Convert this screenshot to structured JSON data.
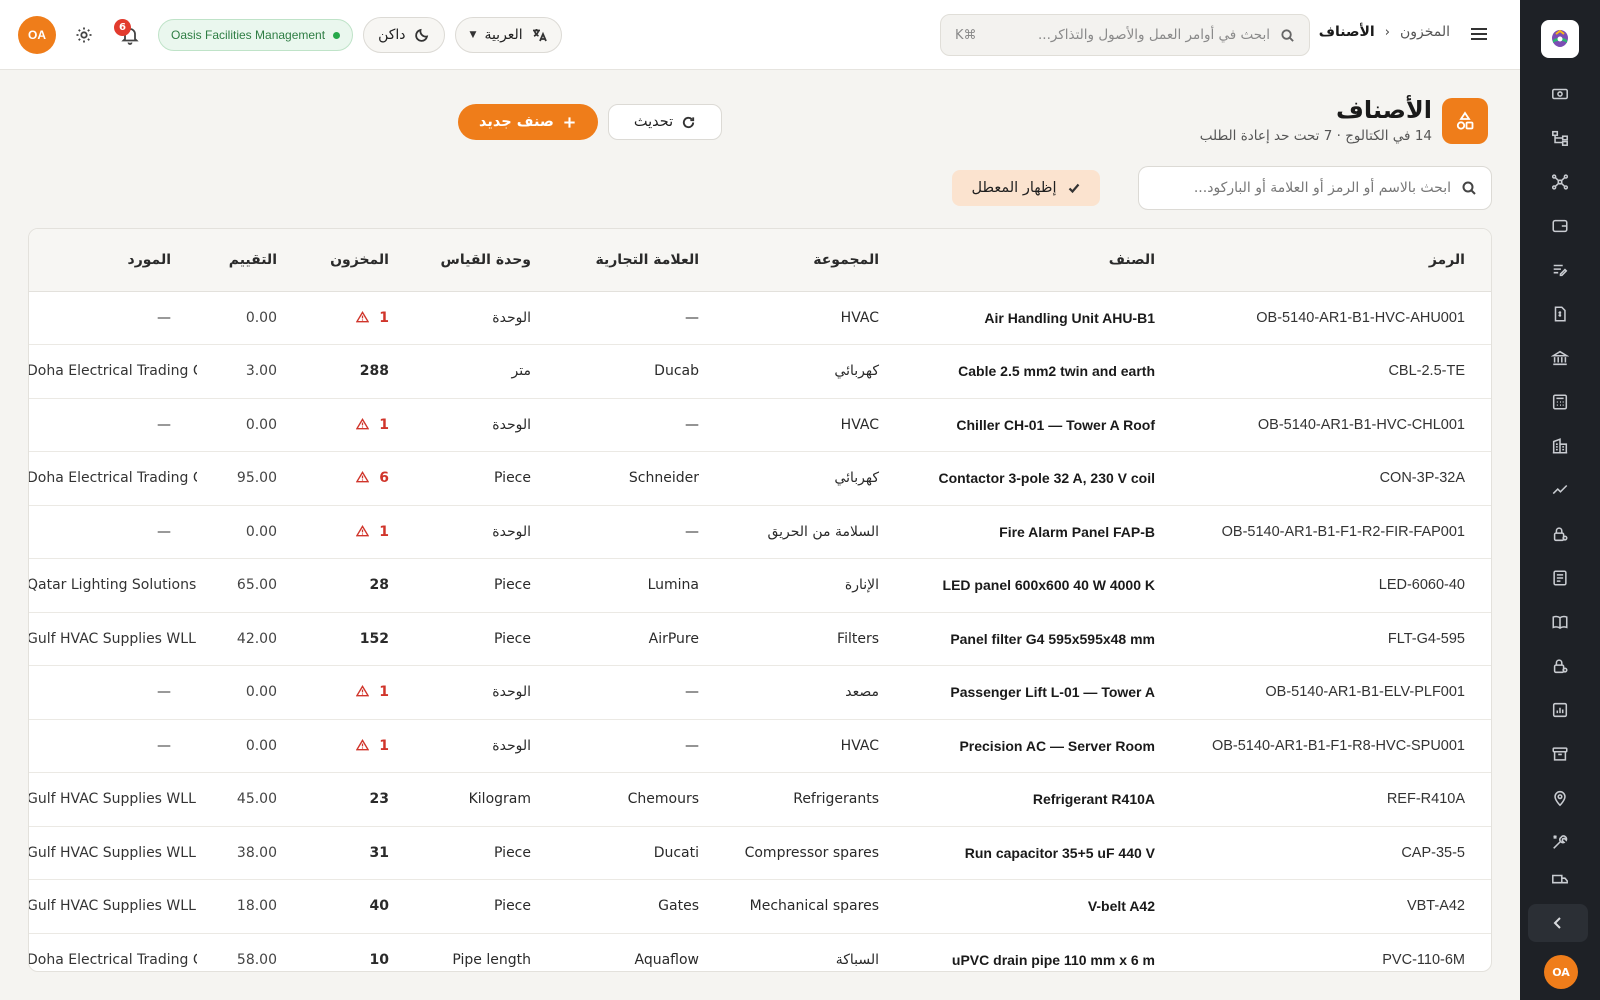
{
  "app": {
    "org_name": "Oasis Facilities Management",
    "user_initials": "OA",
    "notifications_count": "6",
    "language_label": "العربية",
    "theme_label": "داكن",
    "accent_color": "#ef7d1a"
  },
  "topbar": {
    "breadcrumb_parent": "المخزون",
    "breadcrumb_current": "الأصناف",
    "search_placeholder": "ابحث في أوامر العمل والأصول والتذاكر...",
    "search_shortcut": "⌘K"
  },
  "page": {
    "title": "الأصناف",
    "subtitle": "14 في الكتالوج · 7 تحت حد إعادة الطلب",
    "new_button": "صنف جديد",
    "refresh_button": "تحديث",
    "filter_placeholder": "ابحث بالاسم أو الرمز أو العلامة أو الباركود...",
    "show_broken_toggle": "إظهار المعطل"
  },
  "table": {
    "headers": {
      "code": "الرمز",
      "name": "الصنف",
      "group": "المجموعة",
      "brand": "العلامة التجارية",
      "uom": "وحدة القياس",
      "stock": "المخزون",
      "rate": "التقييم",
      "vendor": "المورد"
    },
    "rows": [
      {
        "code": "OB-5140-AR1-B1-HVC-AHU001",
        "name": "Air Handling Unit AHU-B1",
        "group": "HVAC",
        "brand": "—",
        "uom": "الوحدة",
        "stock": "1",
        "low": true,
        "rate": "0.00",
        "vendor": "—"
      },
      {
        "code": "CBL-2.5-TE",
        "name": "Cable 2.5 mm2 twin and earth",
        "group": "كهربائي",
        "brand": "Ducab",
        "uom": "متر",
        "stock": "288",
        "low": false,
        "rate": "3.00",
        "vendor": "Doha Electrical Trading Co"
      },
      {
        "code": "OB-5140-AR1-B1-HVC-CHL001",
        "name": "Chiller CH-01 — Tower A Roof",
        "group": "HVAC",
        "brand": "—",
        "uom": "الوحدة",
        "stock": "1",
        "low": true,
        "rate": "0.00",
        "vendor": "—"
      },
      {
        "code": "CON-3P-32A",
        "name": "Contactor 3-pole 32 A, 230 V coil",
        "group": "كهربائي",
        "brand": "Schneider",
        "uom": "Piece",
        "stock": "6",
        "low": true,
        "rate": "95.00",
        "vendor": "Doha Electrical Trading Co"
      },
      {
        "code": "OB-5140-AR1-B1-F1-R2-FIR-FAP001",
        "name": "Fire Alarm Panel FAP-B",
        "group": "السلامة من الحريق",
        "brand": "—",
        "uom": "الوحدة",
        "stock": "1",
        "low": true,
        "rate": "0.00",
        "vendor": "—"
      },
      {
        "code": "LED-6060-40",
        "name": "LED panel 600x600 40 W 4000 K",
        "group": "الإنارة",
        "brand": "Lumina",
        "uom": "Piece",
        "stock": "28",
        "low": false,
        "rate": "65.00",
        "vendor": "Qatar Lighting Solutions"
      },
      {
        "code": "FLT-G4-595",
        "name": "Panel filter G4 595x595x48 mm",
        "group": "Filters",
        "brand": "AirPure",
        "uom": "Piece",
        "stock": "152",
        "low": false,
        "rate": "42.00",
        "vendor": "Gulf HVAC Supplies WLL"
      },
      {
        "code": "OB-5140-AR1-B1-ELV-PLF001",
        "name": "Passenger Lift L-01 — Tower A",
        "group": "مصعد",
        "brand": "—",
        "uom": "الوحدة",
        "stock": "1",
        "low": true,
        "rate": "0.00",
        "vendor": "—"
      },
      {
        "code": "OB-5140-AR1-B1-F1-R8-HVC-SPU001",
        "name": "Precision AC — Server Room",
        "group": "HVAC",
        "brand": "—",
        "uom": "الوحدة",
        "stock": "1",
        "low": true,
        "rate": "0.00",
        "vendor": "—"
      },
      {
        "code": "REF-R410A",
        "name": "Refrigerant R410A",
        "group": "Refrigerants",
        "brand": "Chemours",
        "uom": "Kilogram",
        "stock": "23",
        "low": false,
        "rate": "45.00",
        "vendor": "Gulf HVAC Supplies WLL"
      },
      {
        "code": "CAP-35-5",
        "name": "Run capacitor 35+5 uF 440 V",
        "group": "Compressor spares",
        "brand": "Ducati",
        "uom": "Piece",
        "stock": "31",
        "low": false,
        "rate": "38.00",
        "vendor": "Gulf HVAC Supplies WLL"
      },
      {
        "code": "VBT-A42",
        "name": "V-belt A42",
        "group": "Mechanical spares",
        "brand": "Gates",
        "uom": "Piece",
        "stock": "40",
        "low": false,
        "rate": "18.00",
        "vendor": "Gulf HVAC Supplies WLL"
      },
      {
        "code": "PVC-110-6M",
        "name": "uPVC drain pipe 110 mm x 6 m",
        "group": "السباكة",
        "brand": "Aquaflow",
        "uom": "Pipe length",
        "stock": "10",
        "low": false,
        "rate": "58.00",
        "vendor": "Doha Electrical Trading Co"
      }
    ]
  },
  "sidebar": {
    "icons": [
      "cash-icon",
      "hierarchy-icon",
      "network-icon",
      "wallet-icon",
      "list-edit-icon",
      "invoice-icon",
      "bank-icon",
      "calculator-icon",
      "building-icon",
      "trend-icon",
      "lock-user-icon",
      "receipt-icon",
      "book-icon",
      "lock-user-icon-2",
      "report-icon",
      "archive-icon",
      "location-icon",
      "tools-icon",
      "truck-icon"
    ]
  }
}
